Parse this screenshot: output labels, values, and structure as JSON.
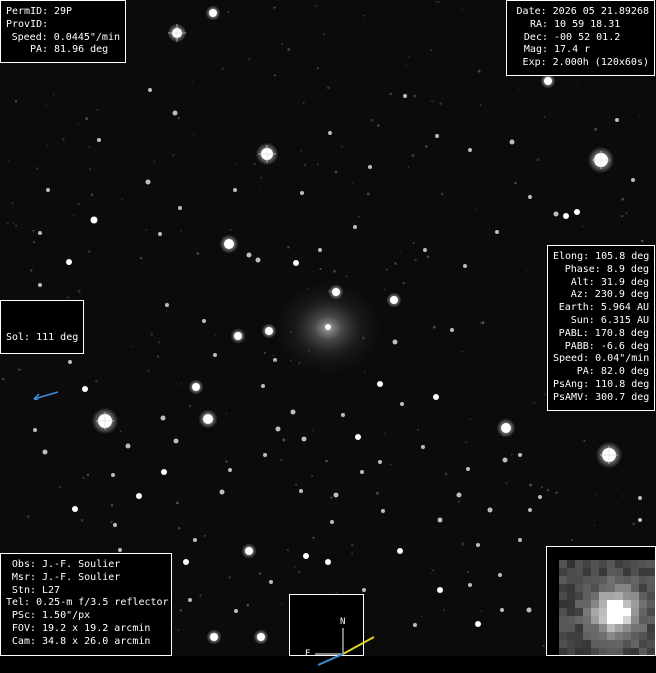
{
  "top_left": {
    "rows": [
      {
        "label": "PermID:",
        "value": " 29P"
      },
      {
        "label": "ProvID:",
        "value": ""
      },
      {
        "label": "Speed:",
        "value": " 0.0445\"/min"
      },
      {
        "label": "PA:",
        "value": " 81.96 deg"
      }
    ]
  },
  "top_right": {
    "rows": [
      {
        "label": "Date:",
        "value": " 2026 05 21.89268"
      },
      {
        "label": "RA:",
        "value": " 10 59 18.31"
      },
      {
        "label": "Dec:",
        "value": " -00 52 01.2"
      },
      {
        "label": "Mag:",
        "value": " 17.4 r"
      },
      {
        "label": "Exp:",
        "value": " 2.000h (120x60s)"
      }
    ]
  },
  "right_panel": {
    "rows": [
      {
        "label": "Elong:",
        "value": " 105.8 deg"
      },
      {
        "label": "Phase:",
        "value": " 8.9 deg"
      },
      {
        "label": "Alt:",
        "value": " 31.9 deg"
      },
      {
        "label": "Az:",
        "value": " 230.9 deg"
      },
      {
        "label": "Earth:",
        "value": " 5.964 AU"
      },
      {
        "label": "Sun:",
        "value": " 6.315 AU"
      },
      {
        "label": "PABL:",
        "value": " 170.8 deg"
      },
      {
        "label": "PABB:",
        "value": " -6.6 deg"
      },
      {
        "label": "Speed:",
        "value": " 0.04\"/min"
      },
      {
        "label": "PA:",
        "value": " 82.0 deg"
      },
      {
        "label": "PsAng:",
        "value": " 110.8 deg"
      },
      {
        "label": "PsAMV:",
        "value": " 300.7 deg"
      }
    ]
  },
  "sol": {
    "label": "Sol: 111 deg",
    "arrow_color": "#3a8fd8"
  },
  "bottom_left": {
    "rows": [
      {
        "label": "Obs:",
        "value": " J.-F. Soulier"
      },
      {
        "label": "Msr:",
        "value": " J.-F. Soulier"
      },
      {
        "label": "Stn:",
        "value": " L27"
      },
      {
        "label": "Tel:",
        "value": " 0.25-m f/3.5 reflector"
      },
      {
        "label": "PSc:",
        "value": " 1.50\"/px"
      },
      {
        "label": "FOV:",
        "value": " 19.2 x 19.2 arcmin"
      },
      {
        "label": "Cam:",
        "value": " 34.8 x 26.0 arcmin"
      }
    ]
  },
  "compass": {
    "north": "N",
    "east": "E",
    "motion_color": "#e0d020",
    "sun_color": "#3a8fd8"
  },
  "colors": {
    "background": "#000000",
    "text": "#ffffff",
    "box_border": "#ffffff"
  }
}
